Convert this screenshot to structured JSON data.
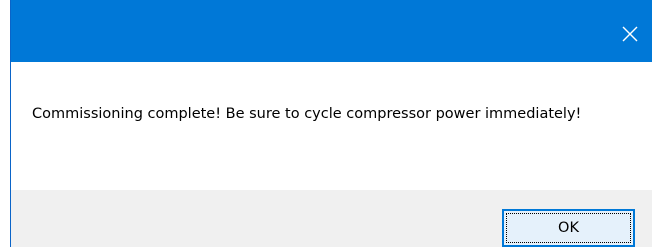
{
  "dialog": {
    "message": "Commissioning complete! Be sure to cycle compressor power immediately!",
    "ok_label": "OK",
    "close_icon": "close-icon"
  },
  "colors": {
    "titlebar": "#0078d7",
    "footer": "#f0f0f0",
    "button_face": "#e5f1fb",
    "button_border": "#0078d7"
  }
}
